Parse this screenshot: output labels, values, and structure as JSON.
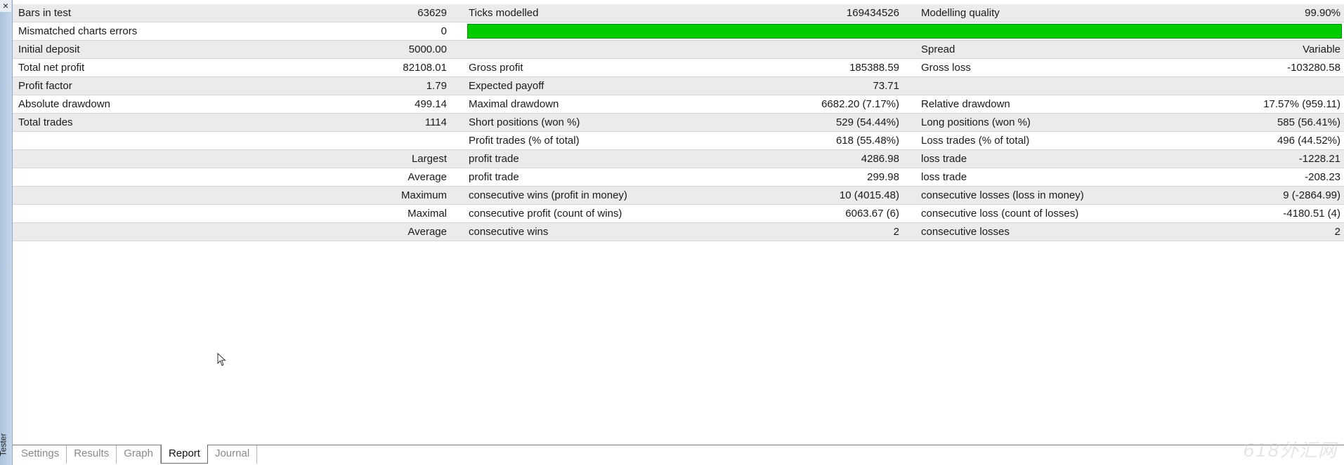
{
  "window": {
    "close_glyph": "×",
    "side_title": "Tester"
  },
  "colors": {
    "quality_bar": "#00cc00",
    "row_shade": "#ebebeb"
  },
  "quality_bar_fill": 1.0,
  "rows": [
    {
      "c1l": "Bars in test",
      "c1r": "63629",
      "c2l": "Ticks modelled",
      "c2r": "169434526",
      "c3l": "Modelling quality",
      "c3r": "99.90%"
    },
    {
      "c1l": "Mismatched charts errors",
      "c1r": "0"
    },
    {
      "c1l": "Initial deposit",
      "c1r": "5000.00",
      "c2l": "",
      "c2r": "",
      "c3l": "Spread",
      "c3r": "Variable"
    },
    {
      "c1l": "Total net profit",
      "c1r": "82108.01",
      "c2l": "Gross profit",
      "c2r": "185388.59",
      "c3l": "Gross loss",
      "c3r": "-103280.58"
    },
    {
      "c1l": "Profit factor",
      "c1r": "1.79",
      "c2l": "Expected payoff",
      "c2r": "73.71",
      "c3l": "",
      "c3r": ""
    },
    {
      "c1l": "Absolute drawdown",
      "c1r": "499.14",
      "c2l": "Maximal drawdown",
      "c2r": "6682.20 (7.17%)",
      "c3l": "Relative drawdown",
      "c3r": "17.57% (959.11)"
    },
    {
      "c1l": "Total trades",
      "c1r": "1114",
      "c2l": "Short positions (won %)",
      "c2r": "529 (54.44%)",
      "c3l": "Long positions (won %)",
      "c3r": "585 (56.41%)"
    },
    {
      "c1l": "",
      "c1r": "",
      "c2l": "Profit trades (% of total)",
      "c2r": "618 (55.48%)",
      "c3l": "Loss trades (% of total)",
      "c3r": "496 (44.52%)"
    },
    {
      "c1l": "",
      "c1r": "Largest",
      "c2l": "profit trade",
      "c2r": "4286.98",
      "c3l": "loss trade",
      "c3r": "-1228.21"
    },
    {
      "c1l": "",
      "c1r": "Average",
      "c2l": "profit trade",
      "c2r": "299.98",
      "c3l": "loss trade",
      "c3r": "-208.23"
    },
    {
      "c1l": "",
      "c1r": "Maximum",
      "c2l": "consecutive wins (profit in money)",
      "c2r": "10 (4015.48)",
      "c3l": "consecutive losses (loss in money)",
      "c3r": "9 (-2864.99)"
    },
    {
      "c1l": "",
      "c1r": "Maximal",
      "c2l": "consecutive profit (count of wins)",
      "c2r": "6063.67 (6)",
      "c3l": "consecutive loss (count of losses)",
      "c3r": "-4180.51 (4)"
    },
    {
      "c1l": "",
      "c1r": "Average",
      "c2l": "consecutive wins",
      "c2r": "2",
      "c3l": "consecutive losses",
      "c3r": "2"
    }
  ],
  "tabs": [
    {
      "label": "Settings",
      "active": false
    },
    {
      "label": "Results",
      "active": false
    },
    {
      "label": "Graph",
      "active": false
    },
    {
      "label": "Report",
      "active": true
    },
    {
      "label": "Journal",
      "active": false
    }
  ],
  "watermark": "618外汇网"
}
